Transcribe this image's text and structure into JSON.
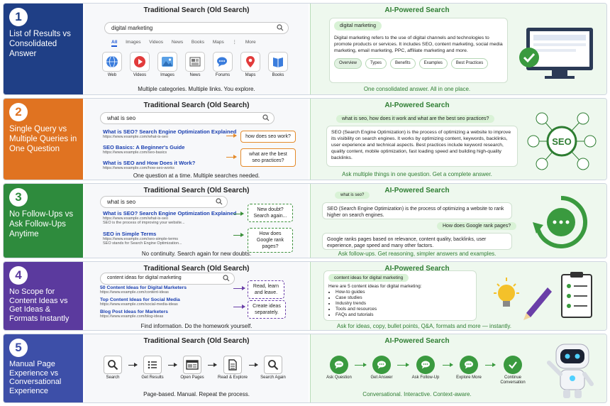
{
  "colors": {
    "row1": "#1f3f86",
    "row2": "#e07321",
    "row3": "#2e8b3d",
    "row4": "#5b3a9e",
    "row5": "#3d4fa8",
    "ai_green": "#2e7d32"
  },
  "rows": [
    {
      "num": "1",
      "title": "List of Results vs Consolidated Answer"
    },
    {
      "num": "2",
      "title": "Single Query vs Multiple Queries in One Question"
    },
    {
      "num": "3",
      "title": "No Follow-Ups vs Ask Follow-Ups Anytime"
    },
    {
      "num": "4",
      "title": "No Scope for Content Ideas vs Get Ideas & Formats Instantly"
    },
    {
      "num": "5",
      "title": "Manual Page Experience vs Conversational Experience"
    }
  ],
  "trad_title": "Traditional Search (Old Search)",
  "ai_title": "AI-Powered Search",
  "r1": {
    "query": "digital marketing",
    "tabs": [
      "All",
      "Images",
      "Videos",
      "News",
      "Books",
      "Maps",
      "⋮",
      "More"
    ],
    "cats": [
      {
        "label": "Web",
        "icon": "globe-icon"
      },
      {
        "label": "Videos",
        "icon": "play-icon"
      },
      {
        "label": "Images",
        "icon": "image-icon"
      },
      {
        "label": "News",
        "icon": "news-icon"
      },
      {
        "label": "Forums",
        "icon": "chat-icon"
      },
      {
        "label": "Maps",
        "icon": "map-pin-icon"
      },
      {
        "label": "Books",
        "icon": "book-icon"
      }
    ],
    "caption": "Multiple categories. Multiple links. You explore.",
    "ai_query": "digital marketing",
    "ai_answer": "Digital marketing refers to the use of digital channels and technologies to promote products or services. It includes SEO, content marketing, social media marketing, email marketing, PPC, affiliate marketing and more.",
    "chips": [
      "Overview",
      "Types",
      "Benefits",
      "Examples",
      "Best Practices"
    ],
    "ai_caption": "One consolidated answer. All in one place."
  },
  "r2": {
    "query": "what is seo",
    "results": [
      {
        "title": "What is SEO? Search Engine Optimization Explained",
        "url": "https://www.example.com/what-is-seo"
      },
      {
        "title": "SEO Basics: A Beginner's Guide",
        "url": "https://www.example.com/seo-basics"
      },
      {
        "title": "What is SEO and How Does it Work?",
        "url": "https://www.example.com/how-seo-works"
      }
    ],
    "side1": "how does seo work?",
    "side2": "what are the best seo practices?",
    "caption": "One question at a time. Multiple searches needed.",
    "ai_query": "what is seo, how does it work and what are the best seo practices?",
    "ai_answer": "SEO (Search Engine Optimization) is the process of optimizing a website to improve its visibility on search engines. It works by optimizing content, keywords, backlinks, user experience and technical aspects. Best practices include keyword research, quality content, mobile optimization, fast loading speed and building high-quality backlinks.",
    "seo_label": "SEO",
    "ai_caption": "Ask multiple things in one question. Get a complete answer."
  },
  "r3": {
    "query": "what is seo",
    "results": [
      {
        "title": "What is SEO? Search Engine Optimization Explained",
        "url": "https://www.example.com/what-is-seo",
        "desc": "SEO is the process of improving your website..."
      },
      {
        "title": "SEO in Simple Terms",
        "url": "https://www.example.com/seo-simple-terms",
        "desc": "SEO stands for Search Engine Optimization..."
      }
    ],
    "side1": "New doubt? Search again...",
    "side2": "How does Google rank pages?",
    "caption": "No continuity. Search again for new doubts.",
    "ai_q1": "what is seo?",
    "ai_a1": "SEO (Search Engine Optimization) is the process of optimizing a website to rank higher on search engines.",
    "ai_q2": "How does Google rank pages?",
    "ai_a2": "Google ranks pages based on relevance, content quality, backlinks, user experience, page speed and many other factors.",
    "ai_caption": "Ask follow-ups. Get reasoning, simpler answers and examples."
  },
  "r4": {
    "query": "content ideas for digital marketing",
    "results": [
      {
        "title": "50 Content Ideas for Digital Marketers",
        "url": "https://www.example.com/content-ideas"
      },
      {
        "title": "Top Content Ideas for Social Media",
        "url": "https://www.example.com/social-media-ideas"
      },
      {
        "title": "Blog Post Ideas for Marketers",
        "url": "https://www.example.com/blog-ideas"
      }
    ],
    "side1": "Read, learn and leave.",
    "side2": "Create ideas separately.",
    "caption": "Find information. Do the homework yourself.",
    "ai_query": "content ideas for digital marketing",
    "ai_intro": "Here are 5 content ideas for digital marketing:",
    "ai_list": [
      "How-to guides",
      "Case studies",
      "Industry trends",
      "Tools and resources",
      "FAQs and tutorials"
    ],
    "ai_caption": "Ask for ideas, copy, bullet points, Q&A, formats and more — instantly."
  },
  "r5": {
    "steps": [
      {
        "label": "Search",
        "icon": "search-icon"
      },
      {
        "label": "Get Results",
        "icon": "list-icon"
      },
      {
        "label": "Open Pages",
        "icon": "browser-icon"
      },
      {
        "label": "Read & Explore",
        "icon": "document-icon"
      },
      {
        "label": "Search Again",
        "icon": "search-icon"
      }
    ],
    "caption": "Page-based. Manual. Repeat the process.",
    "ai_steps": [
      {
        "label": "Ask Question",
        "icon": "chat-icon"
      },
      {
        "label": "Get Answer",
        "icon": "chat-icon"
      },
      {
        "label": "Ask Follow-Up",
        "icon": "chat-icon"
      },
      {
        "label": "Explore More",
        "icon": "chat-icon"
      },
      {
        "label": "Continue Conversation",
        "icon": "check-icon"
      }
    ],
    "ai_caption": "Conversational. Interactive. Context-aware."
  }
}
